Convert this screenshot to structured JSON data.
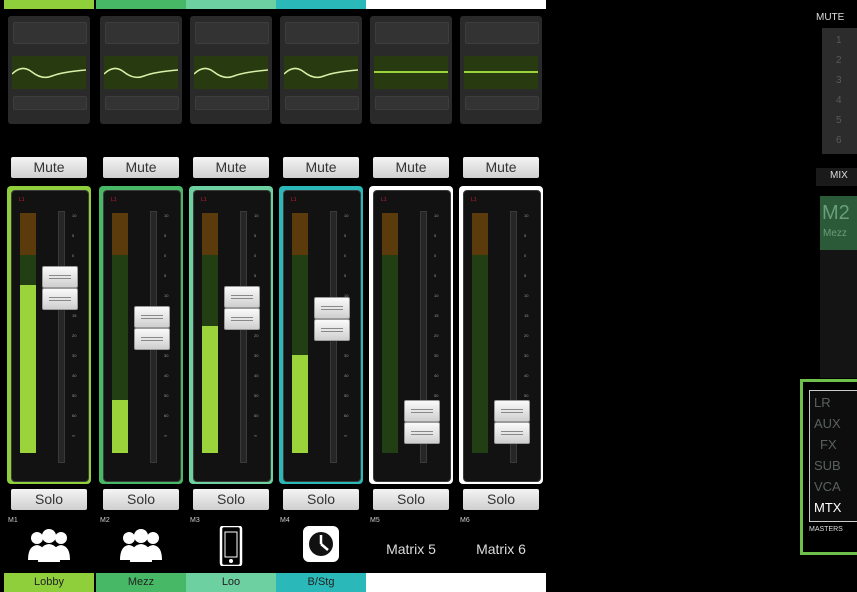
{
  "colors": {
    "green_bright": "#8fcf3c",
    "green_mid": "#47b866",
    "green_light": "#6dd0a0",
    "teal": "#2bb8b8",
    "white": "#ffffff",
    "meter": "#9bd43a",
    "accent_box": "#6fc04a"
  },
  "channels": [
    {
      "id": "M1",
      "name": "Lobby",
      "icon": "people-group-icon",
      "mute": "Mute",
      "solo": "Solo",
      "color": "#8fcf3c",
      "level": 0.7,
      "fader": 0.25,
      "display": ""
    },
    {
      "id": "M2",
      "name": "Mezz",
      "icon": "people-group-icon",
      "mute": "Mute",
      "solo": "Solo",
      "color": "#47b866",
      "level": 0.22,
      "fader": 0.43,
      "display": ""
    },
    {
      "id": "M3",
      "name": "Loo",
      "icon": "phone-icon",
      "mute": "Mute",
      "solo": "Solo",
      "color": "#6dd0a0",
      "level": 0.53,
      "fader": 0.34,
      "display": ""
    },
    {
      "id": "M4",
      "name": "B/Stg",
      "icon": "clock-icon",
      "mute": "Mute",
      "solo": "Solo",
      "color": "#2bb8b8",
      "level": 0.41,
      "fader": 0.39,
      "display": ""
    },
    {
      "id": "M5",
      "name": "",
      "icon": "",
      "mute": "Mute",
      "solo": "Solo",
      "color": "#ffffff",
      "level": 0.0,
      "fader": 0.86,
      "display": "Matrix 5"
    },
    {
      "id": "M6",
      "name": "",
      "icon": "",
      "mute": "Mute",
      "solo": "Solo",
      "color": "#ffffff",
      "level": 0.0,
      "fader": 0.86,
      "display": "Matrix 6"
    }
  ],
  "scale_marks": [
    "10",
    "5",
    "0",
    "5",
    "10",
    "15",
    "20",
    "30",
    "40",
    "50",
    "60",
    "∞"
  ],
  "right_panel": {
    "mute_label": "MUTE",
    "mute_groups": [
      "1",
      "2",
      "3",
      "4",
      "5",
      "6"
    ],
    "mix_label": "MIX",
    "mix_id": "M2",
    "mix_name": "Mezz",
    "masters_items": [
      "LR",
      "AUX",
      "FX",
      "SUB",
      "VCA",
      "MTX"
    ],
    "masters_selected": "MTX",
    "masters_label": "MASTERS"
  }
}
